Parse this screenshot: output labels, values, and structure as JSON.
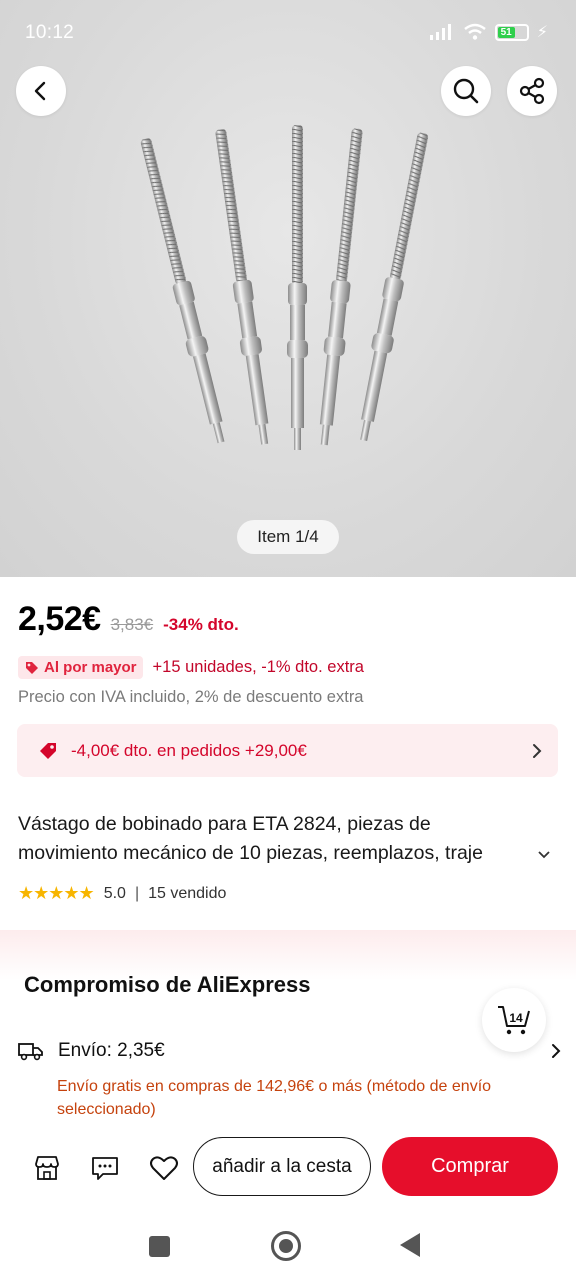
{
  "status_bar": {
    "time": "10:12",
    "battery": "51"
  },
  "hero": {
    "pager": "Item 1/4"
  },
  "price": {
    "current": "2,52€",
    "original": "3,83€",
    "discount": "-34% dto."
  },
  "wholesale": {
    "badge": "Al por mayor",
    "text": "+15 unidades, -1% dto. extra"
  },
  "tax_note": "Precio con IVA incluido, 2% de descuento extra",
  "coupon": {
    "text": "-4,00€ dto. en pedidos +29,00€"
  },
  "product": {
    "title_line1": "Vástago de bobinado para ETA 2824, piezas de",
    "title_line2": "movimiento mecánico de 10 piezas, reemplazos, traje",
    "rating": "5.0",
    "rating_stars": 5,
    "sold": "15 vendido"
  },
  "commitment": {
    "title": "Compromiso de AliExpress",
    "cart_count": "14"
  },
  "shipping": {
    "label": "Envío: 2,35€",
    "note": "Envío gratis en compras de 142,96€ o más (método de envío seleccionado)"
  },
  "actions": {
    "add_to_cart": "añadir a la cesta",
    "buy": "Comprar"
  },
  "colors": {
    "accent": "#e60e2b",
    "discount": "#d4052b",
    "star": "#f7b500"
  }
}
